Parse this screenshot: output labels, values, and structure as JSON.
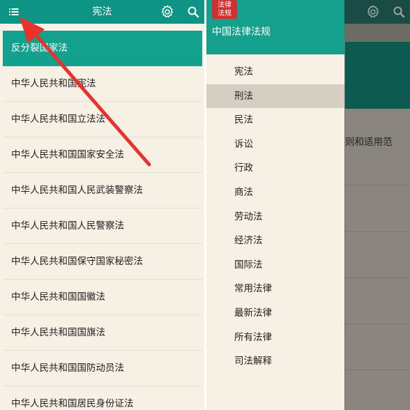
{
  "left": {
    "title": "宪法",
    "icons": {
      "menu": "menu-list-icon",
      "settings": "gear-icon",
      "search": "search-icon"
    },
    "list": [
      "反分裂国家法",
      "中华人民共和国宪法",
      "中华人民共和国立法法",
      "中华人民共和国国家安全法",
      "中华人民共和国人民武装警察法",
      "中华人民共和国人民警察法",
      "中华人民共和国保守国家秘密法",
      "中华人民共和国国徽法",
      "中华人民共和国国旗法",
      "中华人民共和国国防动员法",
      "中华人民共和国居民身份证法"
    ]
  },
  "drawer": {
    "logo_line1": "法律",
    "logo_line2": "法规",
    "app_name": "中国法律法规",
    "items": [
      "宪法",
      "刑法",
      "民法",
      "诉讼",
      "行政",
      "商法",
      "劳动法",
      "经济法",
      "国际法",
      "常用法律",
      "最新法律",
      "所有法律",
      "司法解释"
    ],
    "selected": "刑法"
  },
  "right": {
    "partial_text": "则和适用范"
  },
  "colors": {
    "appbar": "#0e9484",
    "active_row": "#13a08d",
    "background": "#f7f0e4",
    "arrow": "#e8322b",
    "logo": "#d32f2f"
  },
  "annotation": {
    "type": "arrow",
    "target": "menu-list-icon"
  }
}
